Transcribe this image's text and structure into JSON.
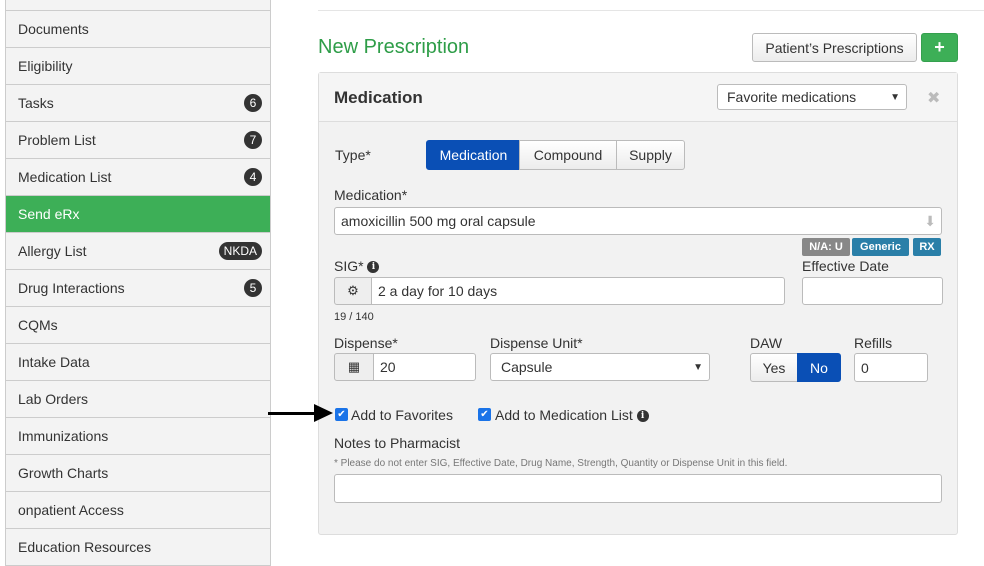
{
  "sidebar": {
    "items": [
      {
        "label": "",
        "badge": null
      },
      {
        "label": "Documents",
        "badge": null
      },
      {
        "label": "Eligibility",
        "badge": null
      },
      {
        "label": "Tasks",
        "badge": "6"
      },
      {
        "label": "Problem List",
        "badge": "7"
      },
      {
        "label": "Medication List",
        "badge": "4"
      },
      {
        "label": "Send eRx",
        "badge": null,
        "active": true
      },
      {
        "label": "Allergy List",
        "badge": "NKDA"
      },
      {
        "label": "Drug Interactions",
        "badge": "5"
      },
      {
        "label": "CQMs",
        "badge": null
      },
      {
        "label": "Intake Data",
        "badge": null
      },
      {
        "label": "Lab Orders",
        "badge": null
      },
      {
        "label": "Immunizations",
        "badge": null
      },
      {
        "label": "Growth Charts",
        "badge": null
      },
      {
        "label": "onpatient Access",
        "badge": null
      },
      {
        "label": "Education Resources",
        "badge": null
      }
    ]
  },
  "page": {
    "title": "New Prescription",
    "patient_prescriptions": "Patient’s Prescriptions",
    "add": "+"
  },
  "panel": {
    "title": "Medication",
    "favorites_select": "Favorite medications",
    "close": "✖",
    "type_label": "Type*",
    "types": [
      "Medication",
      "Compound",
      "Supply"
    ],
    "type_selected": "Medication",
    "medication_label": "Medication*",
    "medication_value": "amoxicillin 500 mg oral capsule",
    "tags": [
      "N/A: U",
      "Generic",
      "RX"
    ],
    "sig_label": "SIG*",
    "sig_value": "2 a day for 10 days",
    "sig_count": "19 / 140",
    "effective_date_label": "Effective Date",
    "effective_date_value": "",
    "dispense_label": "Dispense*",
    "dispense_value": "20",
    "dispense_unit_label": "Dispense Unit*",
    "dispense_unit_value": "Capsule",
    "daw_label": "DAW",
    "daw_options": [
      "Yes",
      "No"
    ],
    "daw_selected": "No",
    "refills_label": "Refills",
    "refills_value": "0",
    "add_favorites": "Add to Favorites",
    "add_favorites_checked": true,
    "add_medication_list": "Add to Medication List",
    "add_medication_list_checked": true,
    "notes_label": "Notes to Pharmacist",
    "notes_hint": "* Please do not enter SIG, Effective Date, Drug Name, Strength, Quantity or Dispense Unit in this field.",
    "notes_value": ""
  },
  "colors": {
    "accent_green": "#3daf57",
    "title_green": "#2e9d48",
    "selected_blue": "#0a4fb5",
    "tag_gray": "#888888",
    "tag_teal": "#2a7fa8"
  }
}
